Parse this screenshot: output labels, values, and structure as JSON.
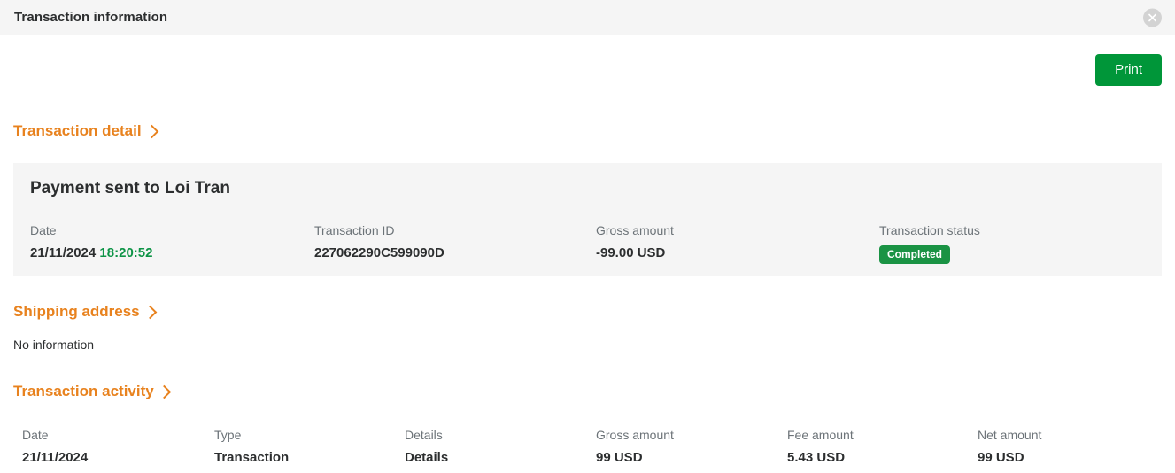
{
  "header": {
    "title": "Transaction information",
    "close_icon": "close-icon"
  },
  "toolbar": {
    "print_label": "Print"
  },
  "sections": {
    "transaction_detail": {
      "heading": "Transaction detail",
      "chevron_icon": "chevron-right-icon",
      "panel_title": "Payment sent to Loi Tran",
      "fields": [
        {
          "label": "Date",
          "value": "21/11/2024",
          "extra": "18:20:52"
        },
        {
          "label": "Transaction ID",
          "value": "227062290C599090D"
        },
        {
          "label": "Gross amount",
          "value": "-99.00 USD"
        },
        {
          "label": "Transaction status",
          "badge": "Completed"
        }
      ]
    },
    "shipping_address": {
      "heading": "Shipping address",
      "chevron_icon": "chevron-right-icon",
      "body": "No information"
    },
    "transaction_activity": {
      "heading": "Transaction activity",
      "chevron_icon": "chevron-right-icon",
      "columns": [
        "Date",
        "Type",
        "Details",
        "Gross amount",
        "Fee amount",
        "Net amount"
      ],
      "rows": [
        [
          "21/11/2024",
          "Transaction",
          "Details",
          "99 USD",
          "5.43 USD",
          "99 USD"
        ]
      ]
    }
  },
  "colors": {
    "accent_orange": "#e8821e",
    "brand_green": "#009639",
    "status_green": "#1a9344",
    "time_green": "#0d9446",
    "panel_gray": "#f5f5f5",
    "label_gray": "#6c7378",
    "text_dark": "#2c2e2f"
  }
}
